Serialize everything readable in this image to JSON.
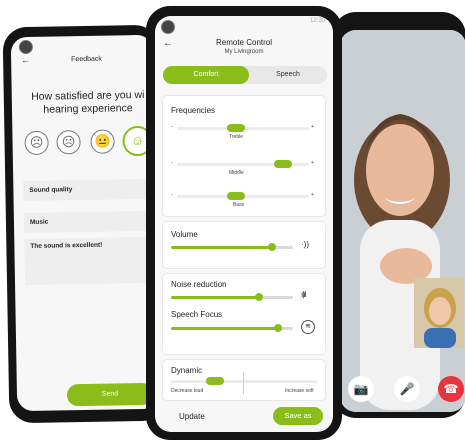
{
  "left_phone": {
    "title": "Feedback",
    "back_icon": "←",
    "question": "How satisfied are you wi hearing experience",
    "faces": [
      "angry-face",
      "sad-face",
      "neutral-face",
      "happy-face"
    ],
    "rows": [
      "Sound quality",
      "Music",
      "The sound is excellent!"
    ],
    "send_label": "Send"
  },
  "middle_phone": {
    "status_time": "12:30",
    "back_icon": "←",
    "title": "Remote Control",
    "subtitle": "My Livingroom",
    "tabs": [
      {
        "label": "Comfort",
        "active": true
      },
      {
        "label": "Speech",
        "active": false
      }
    ],
    "frequencies": {
      "label": "Frequencies",
      "bands": [
        {
          "label": "Treble",
          "level": 0.45
        },
        {
          "label": "Middle",
          "level": 0.8
        },
        {
          "label": "Bass",
          "level": 0.45
        }
      ],
      "minus": "-",
      "plus": "+"
    },
    "volume": {
      "label": "Volume",
      "level": 0.83,
      "icon": "speaker-icon"
    },
    "noise_reduction": {
      "label": "Noise reduction",
      "level": 0.72,
      "icon": "sound-wave-icon"
    },
    "speech_focus": {
      "label": "Speech Focus",
      "level": 0.88,
      "icon": "focus-icon"
    },
    "dynamic": {
      "label": "Dynamic",
      "decrease": "Decrease loud",
      "increase": "Increase soft",
      "level": 0.3
    },
    "update_label": "Update",
    "save_label": "Save as"
  },
  "right_phone": {
    "call_buttons": [
      "camera-icon",
      "microphone-icon",
      "hang-up-icon"
    ]
  },
  "colors": {
    "accent": "#8bbd1a",
    "hangup": "#e8343f"
  }
}
